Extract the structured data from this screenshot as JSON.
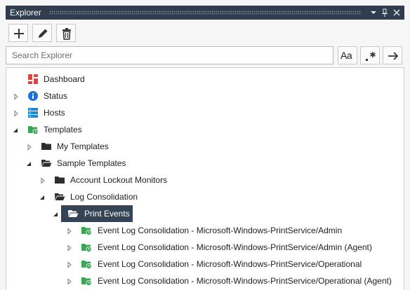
{
  "window": {
    "title": "Explorer"
  },
  "search": {
    "placeholder": "Search Explorer",
    "value": "",
    "match_case_label": "Aa"
  },
  "tree": [
    {
      "label": "Dashboard",
      "icon": "dashboard-icon"
    },
    {
      "label": "Status",
      "icon": "info-icon"
    },
    {
      "label": "Hosts",
      "icon": "hosts-icon"
    },
    {
      "label": "Templates",
      "icon": "templates-folder-icon"
    },
    {
      "label": "My Templates",
      "icon": "folder-icon"
    },
    {
      "label": "Sample Templates",
      "icon": "folder-open-icon"
    },
    {
      "label": "Account Lockout Monitors",
      "icon": "folder-icon"
    },
    {
      "label": "Log Consolidation",
      "icon": "folder-open-icon"
    },
    {
      "label": "Print Events",
      "icon": "folder-open-icon",
      "selected": true
    },
    {
      "label": "Event Log Consolidation - Microsoft-Windows-PrintService/Admin",
      "icon": "template-icon"
    },
    {
      "label": "Event Log Consolidation - Microsoft-Windows-PrintService/Admin (Agent)",
      "icon": "template-icon"
    },
    {
      "label": "Event Log Consolidation - Microsoft-Windows-PrintService/Operational",
      "icon": "template-icon"
    },
    {
      "label": "Event Log Consolidation - Microsoft-Windows-PrintService/Operational (Agent)",
      "icon": "template-icon"
    }
  ],
  "colors": {
    "titlebar": "#2f3d4e",
    "selection": "#344454",
    "accent_green": "#3aa655",
    "dashboard_red": "#d9463e",
    "info_blue": "#1a73d9"
  }
}
